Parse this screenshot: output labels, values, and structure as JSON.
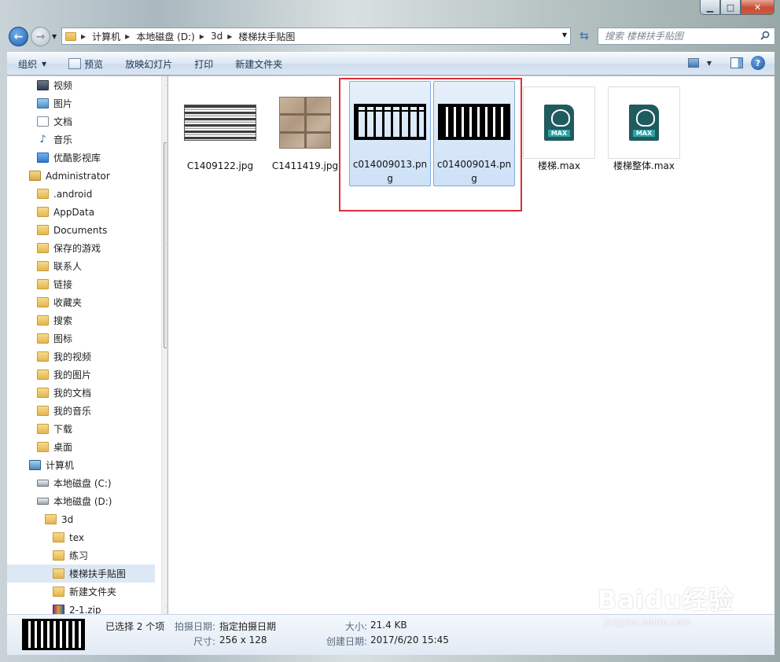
{
  "address": {
    "crumbs": [
      "计算机",
      "本地磁盘 (D:)",
      "3d",
      "楼梯扶手贴图"
    ]
  },
  "search": {
    "placeholder": "搜索 楼梯扶手贴图"
  },
  "toolbar": {
    "organize": "组织",
    "preview": "预览",
    "slideshow": "放映幻灯片",
    "print": "打印",
    "new_folder": "新建文件夹"
  },
  "nav": {
    "items": [
      {
        "label": "视频",
        "icon": "video-icon"
      },
      {
        "label": "图片",
        "icon": "picture-icon"
      },
      {
        "label": "文档",
        "icon": "document-icon"
      },
      {
        "label": "音乐",
        "icon": "music-icon"
      },
      {
        "label": "优酷影视库",
        "icon": "youku-icon"
      },
      {
        "label": "Administrator",
        "icon": "user-folder-icon"
      },
      {
        "label": ".android",
        "icon": "folder-icon"
      },
      {
        "label": "AppData",
        "icon": "folder-icon"
      },
      {
        "label": "Documents",
        "icon": "folder-icon"
      },
      {
        "label": "保存的游戏",
        "icon": "folder-icon"
      },
      {
        "label": "联系人",
        "icon": "folder-icon"
      },
      {
        "label": "链接",
        "icon": "folder-icon"
      },
      {
        "label": "收藏夹",
        "icon": "folder-icon"
      },
      {
        "label": "搜索",
        "icon": "folder-icon"
      },
      {
        "label": "图标",
        "icon": "folder-icon"
      },
      {
        "label": "我的视频",
        "icon": "folder-icon"
      },
      {
        "label": "我的图片",
        "icon": "folder-icon"
      },
      {
        "label": "我的文档",
        "icon": "folder-icon"
      },
      {
        "label": "我的音乐",
        "icon": "folder-icon"
      },
      {
        "label": "下载",
        "icon": "folder-icon"
      },
      {
        "label": "桌面",
        "icon": "folder-icon"
      },
      {
        "label": "计算机",
        "icon": "computer-icon"
      },
      {
        "label": "本地磁盘 (C:)",
        "icon": "drive-icon"
      },
      {
        "label": "本地磁盘 (D:)",
        "icon": "drive-icon"
      },
      {
        "label": "3d",
        "icon": "folder-icon"
      },
      {
        "label": "tex",
        "icon": "folder-icon"
      },
      {
        "label": "练习",
        "icon": "folder-icon"
      },
      {
        "label": "楼梯扶手贴图",
        "icon": "folder-icon",
        "selected": true
      },
      {
        "label": "新建文件夹",
        "icon": "folder-icon"
      },
      {
        "label": "2-1.zip",
        "icon": "zip-icon"
      }
    ]
  },
  "files": [
    {
      "name": "C1409122.jpg",
      "thumb": "stripes",
      "selected": false
    },
    {
      "name": "C1411419.jpg",
      "thumb": "tiles",
      "selected": false
    },
    {
      "name": "c014009013.png",
      "thumb": "railing-a",
      "selected": true
    },
    {
      "name": "c014009014.png",
      "thumb": "railing-b",
      "selected": true
    },
    {
      "name": "楼梯.max",
      "thumb": "max",
      "selected": false
    },
    {
      "name": "楼梯整体.max",
      "thumb": "max",
      "selected": false
    }
  ],
  "max_icon_label": "MAX",
  "details": {
    "selected_count": "已选择 2 个项",
    "date_taken_label": "拍摄日期:",
    "date_taken_value": "指定拍摄日期",
    "dimensions_label": "尺寸:",
    "dimensions_value": "256 x 128",
    "size_label": "大小:",
    "size_value": "21.4 KB",
    "created_label": "创建日期:",
    "created_value": "2017/6/20 15:45"
  },
  "watermark": {
    "logo": "Baidu经验",
    "url": "jingyan.baidu.com"
  },
  "colors": {
    "highlight": "#d9303b",
    "selection": "#cde1f7",
    "toolbar": "#dce7f3"
  }
}
